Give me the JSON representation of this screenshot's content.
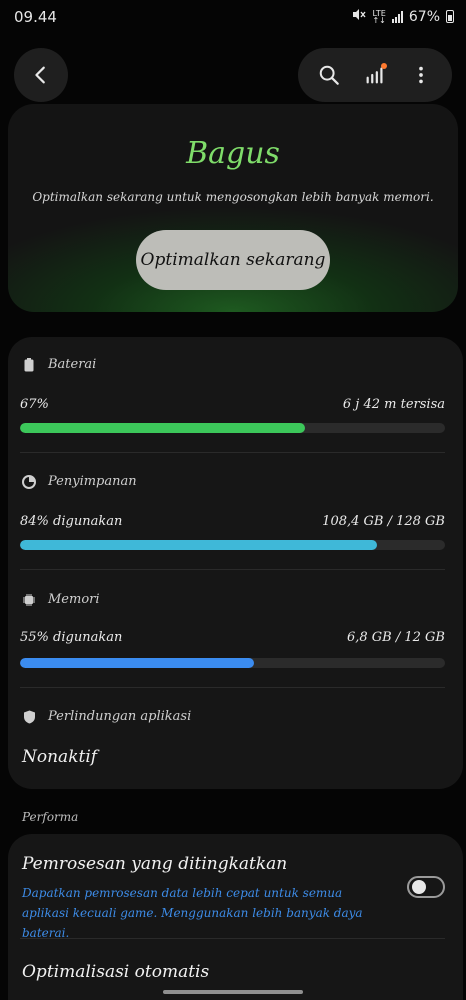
{
  "status_bar": {
    "time": "09.44",
    "network_top": "LTE",
    "network_bottom": "↑↓",
    "battery": "67%"
  },
  "nav": {
    "back_icon": "chevron-left-icon",
    "search_icon": "search-icon",
    "chart_icon": "signal-bars-icon",
    "more_icon": "more-vertical-icon"
  },
  "hero": {
    "title": "Bagus",
    "description": "Optimalkan sekarang untuk mengosongkan lebih banyak memori.",
    "button_label": "Optimalkan sekarang"
  },
  "stats": {
    "battery": {
      "label": "Baterai",
      "value": "67%",
      "detail": "6 j 42 m tersisa",
      "fraction": 0.67,
      "color": "#3cc75a"
    },
    "storage": {
      "label": "Penyimpanan",
      "value": "84% digunakan",
      "detail": "108,4 GB / 128 GB",
      "fraction": 0.84,
      "color": "#3fb8d8"
    },
    "memory": {
      "label": "Memori",
      "value": "55% digunakan",
      "detail": "6,8 GB / 12 GB",
      "fraction": 0.55,
      "color": "#3b8cf0"
    },
    "protection": {
      "label": "Perlindungan aplikasi",
      "value": "Nonaktif"
    }
  },
  "performance": {
    "section_label": "Performa",
    "enhanced_title": "Pemrosesan yang ditingkatkan",
    "enhanced_desc": "Dapatkan pemrosesan data lebih cepat untuk semua aplikasi kecuali game. Menggunakan lebih banyak daya baterai.",
    "enhanced_on": false,
    "auto_title": "Optimalisasi otomatis"
  },
  "colors": {
    "accent_green": "#7fdc6a",
    "accent_blue": "#3d8ce8",
    "badge_orange": "#ff7a2f"
  }
}
